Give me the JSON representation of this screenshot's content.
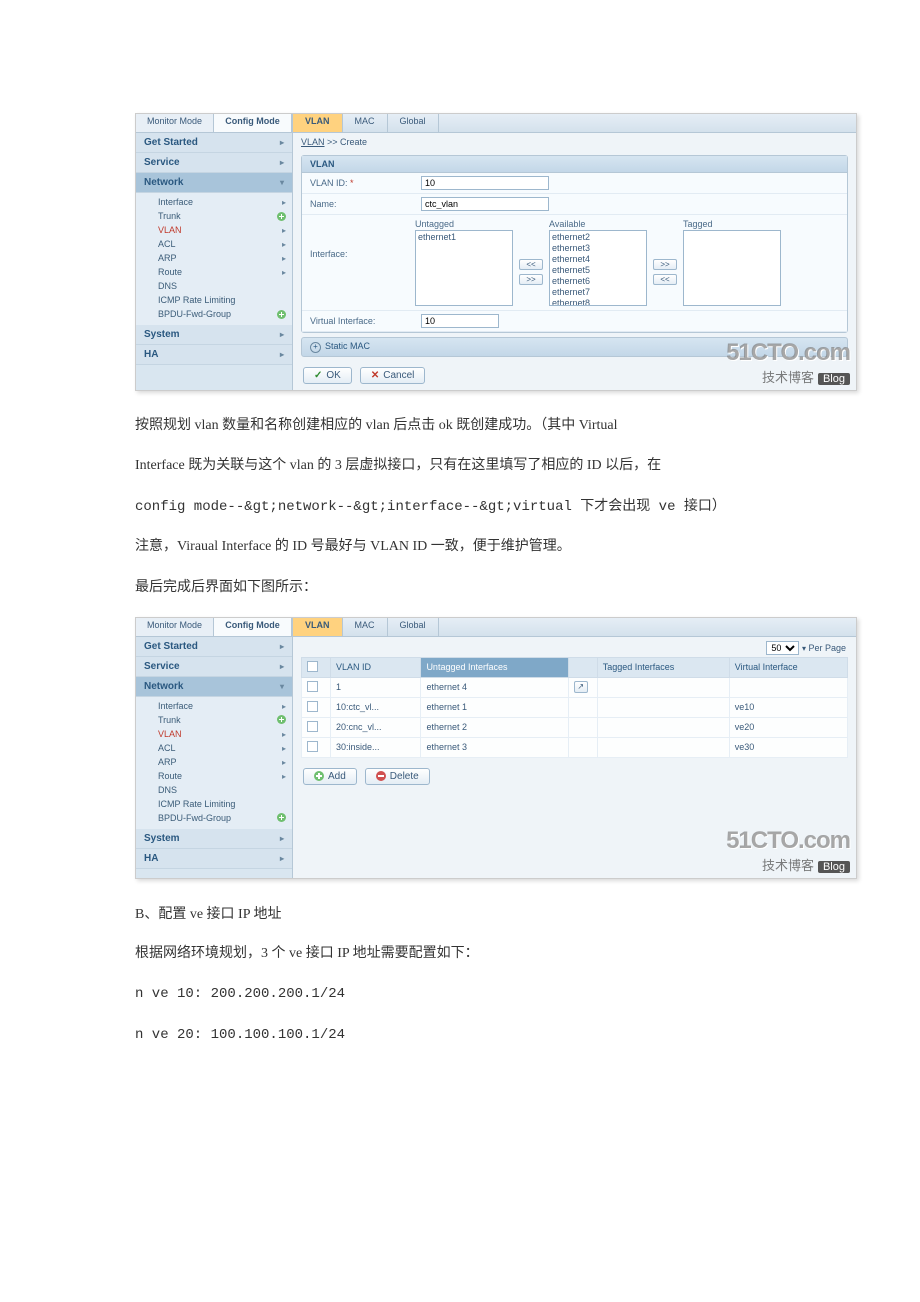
{
  "sidebar": {
    "modes": {
      "monitor": "Monitor Mode",
      "config": "Config Mode"
    },
    "sections": {
      "get_started": "Get Started",
      "service": "Service",
      "network": "Network",
      "system": "System",
      "ha": "HA"
    },
    "network_items": {
      "interface": "Interface",
      "trunk": "Trunk",
      "vlan": "VLAN",
      "acl": "ACL",
      "arp": "ARP",
      "route": "Route",
      "dns": "DNS",
      "icmp": "ICMP Rate Limiting",
      "bpdu": "BPDU-Fwd-Group"
    }
  },
  "tabs": {
    "vlan": "VLAN",
    "mac": "MAC",
    "global": "Global"
  },
  "shot1": {
    "breadcrumb_a": "VLAN",
    "breadcrumb_sep": " >> ",
    "breadcrumb_b": "Create",
    "panel_title": "VLAN",
    "vlan_id_label": "VLAN ID:",
    "vlan_id_star": "*",
    "vlan_id_value": "10",
    "name_label": "Name:",
    "name_value": "ctc_vlan",
    "interface_label": "Interface:",
    "col_untagged": "Untagged",
    "col_available": "Available",
    "col_tagged": "Tagged",
    "untagged_list": [
      "ethernet1"
    ],
    "available_list": [
      "ethernet2",
      "ethernet3",
      "ethernet4",
      "ethernet5",
      "ethernet6",
      "ethernet7",
      "ethernet8"
    ],
    "tagged_list": [],
    "btn_ll": "<<",
    "btn_rr": ">>",
    "virtual_if_label": "Virtual Interface:",
    "virtual_if_value": "10",
    "static_mac_title": "Static MAC",
    "ok_label": "OK",
    "cancel_label": "Cancel"
  },
  "prose": {
    "p1": "按照规划 vlan 数量和名称创建相应的 vlan 后点击 ok 既创建成功。（其中 Virtual",
    "p2": "Interface 既为关联与这个 vlan 的 3 层虚拟接口，只有在这里填写了相应的 ID 以后，在",
    "p3": "config mode--&gt;network--&gt;interface--&gt;virtual 下才会出现 ve 接口）",
    "p4": "注意，Viraual Interface 的 ID 号最好与 VLAN ID 一致，便于维护管理。",
    "p5": "最后完成后界面如下图所示：",
    "h_b": "B、配置 ve 接口 IP 地址",
    "p6": "根据网络环境规划，3 个 ve 接口 IP 地址需要配置如下：",
    "p7": "n ve 10: 200.200.200.1/24",
    "p8": "n ve 20: 100.100.100.1/24"
  },
  "shot2": {
    "perpage_value": "50",
    "perpage_label": "Per Page",
    "th_vlan_id": "VLAN ID",
    "th_untagged": "Untagged Interfaces",
    "th_tagged": "Tagged Interfaces",
    "th_virtual": "Virtual Interface",
    "rows": [
      {
        "id": "1",
        "untag": "ethernet 4",
        "jump": true,
        "tag": "",
        "ve": ""
      },
      {
        "id": "10:ctc_vl...",
        "untag": "ethernet 1",
        "jump": false,
        "tag": "",
        "ve": "ve10"
      },
      {
        "id": "20:cnc_vl...",
        "untag": "ethernet 2",
        "jump": false,
        "tag": "",
        "ve": "ve20"
      },
      {
        "id": "30:inside...",
        "untag": "ethernet 3",
        "jump": false,
        "tag": "",
        "ve": "ve30"
      }
    ],
    "add_label": "Add",
    "delete_label": "Delete"
  },
  "watermark": {
    "top": "51CTO.com",
    "bot": "技术博客",
    "blog": "Blog"
  }
}
